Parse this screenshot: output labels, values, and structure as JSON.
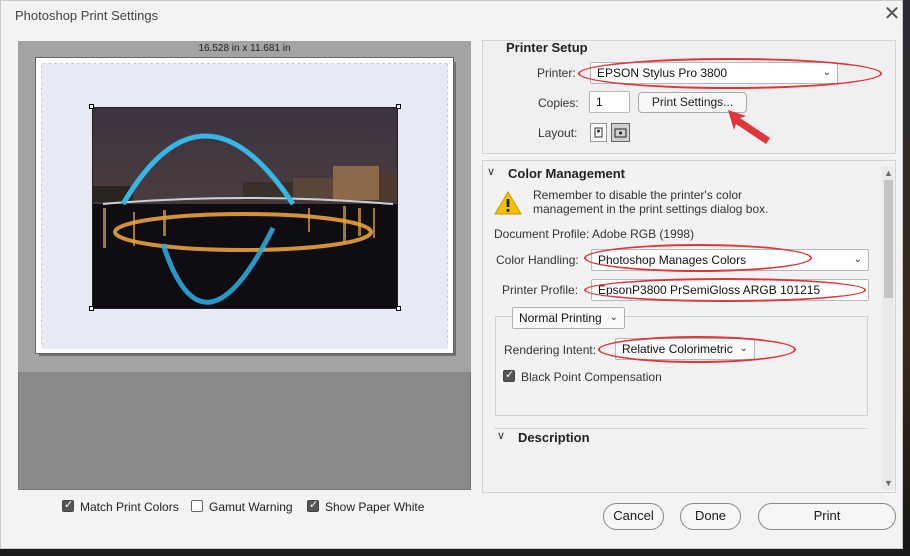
{
  "window": {
    "title": "Photoshop Print Settings"
  },
  "preview": {
    "dimensions": "16.528 in x 11.681 in"
  },
  "bottom_options": [
    {
      "label": "Match Print Colors",
      "checked": true
    },
    {
      "label": "Gamut Warning",
      "checked": false
    },
    {
      "label": "Show Paper White",
      "checked": true
    }
  ],
  "printer_setup": {
    "title": "Printer Setup",
    "printer_label": "Printer:",
    "printer_value": "EPSON Stylus Pro 3800",
    "copies_label": "Copies:",
    "copies_value": "1",
    "print_settings_button": "Print Settings...",
    "layout_label": "Layout:"
  },
  "color_management": {
    "title": "Color Management",
    "warning_line1": "Remember to disable the printer's color",
    "warning_line2": "management in the print settings dialog box.",
    "document_profile": "Document Profile: Adobe RGB (1998)",
    "color_handling_label": "Color Handling:",
    "color_handling_value": "Photoshop Manages Colors",
    "printer_profile_label": "Printer Profile:",
    "printer_profile_value": "EpsonP3800 PrSemiGloss ARGB 101215",
    "mode_value": "Normal Printing",
    "rendering_intent_label": "Rendering Intent:",
    "rendering_intent_value": "Relative Colorimetric",
    "black_point_label": "Black Point Compensation",
    "black_point_checked": true
  },
  "description": {
    "title": "Description"
  },
  "buttons": {
    "cancel": "Cancel",
    "done": "Done",
    "print": "Print"
  },
  "colors": {
    "annotation_red": "#e0353a",
    "warning_yellow": "#f2c200"
  },
  "icons": {
    "close": "close-icon",
    "warning": "warning-icon",
    "chevron": "chevron-down-icon",
    "portrait": "portrait-layout-icon",
    "landscape": "landscape-layout-icon",
    "arrow": "annotation-arrow-icon"
  }
}
